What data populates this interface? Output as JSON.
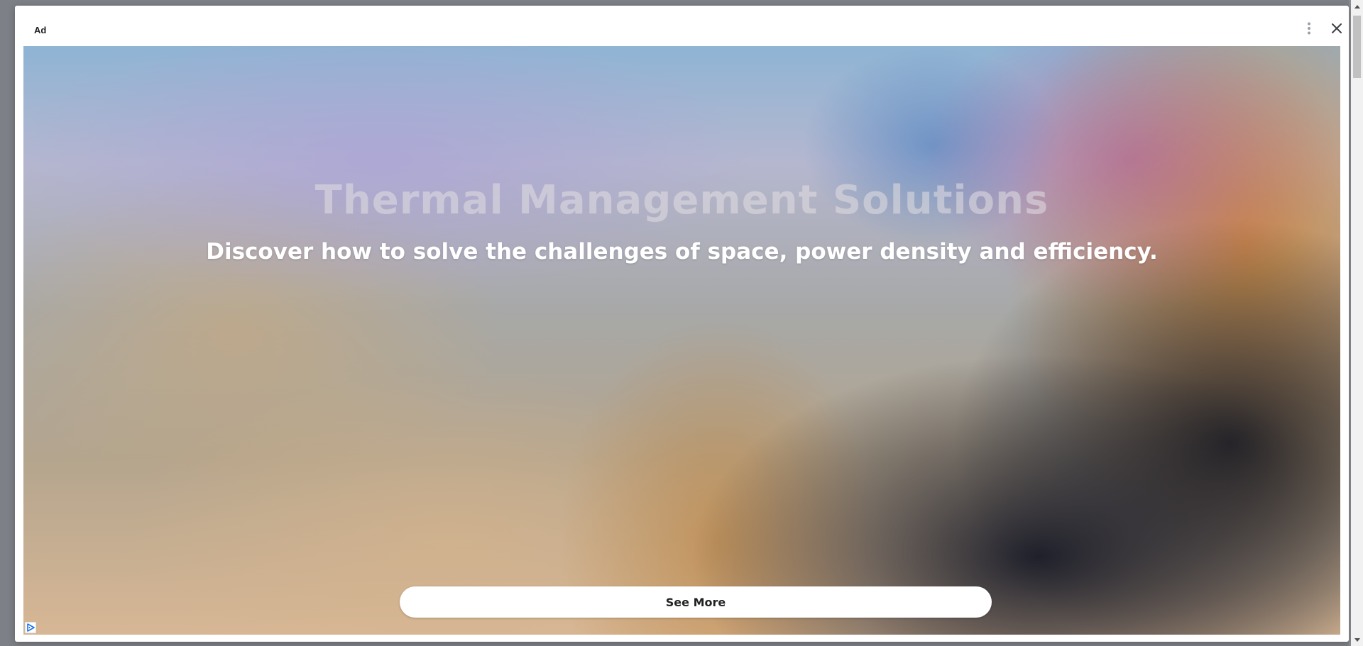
{
  "ad_modal": {
    "label": "Ad",
    "menu_icon": "more-vertical-icon",
    "close_icon": "close-icon"
  },
  "creative": {
    "headline": "Thermal Management Solutions",
    "subheadline": "Discover how to solve the challenges of space, power density and efficiency.",
    "cta_label": "See More",
    "adchoices_icon": "adchoices-icon"
  },
  "scrollbar": {
    "up_icon": "scroll-up-arrow-icon",
    "down_icon": "scroll-down-arrow-icon"
  },
  "colors": {
    "modal_background": "#ffffff",
    "page_overlay": "#7d8086",
    "cta_background": "#ffffff",
    "subheadline_text": "#ffffff",
    "adchoices_blue": "#1a73e8"
  }
}
